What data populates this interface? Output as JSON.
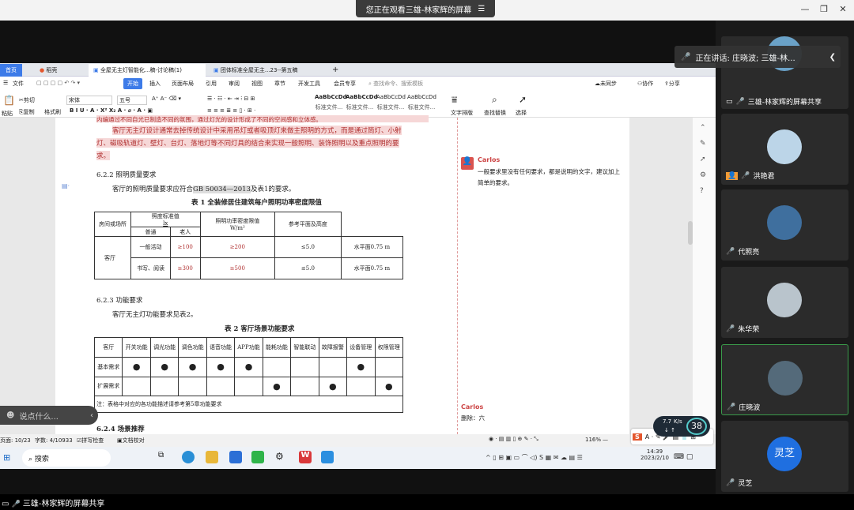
{
  "meeting": {
    "banner": "您正在观看三雄-林家辉的屏幕",
    "speaking": "正在讲话: 庄晓波; 三雄-林...",
    "share_label": "三雄-林家辉的屏幕共享",
    "chat_placeholder": "说点什么..."
  },
  "participants": [
    {
      "name": "三雄-林家辉的屏幕共享"
    },
    {
      "name": "洪艳君"
    },
    {
      "name": "代照亮"
    },
    {
      "name": "朱华荣"
    },
    {
      "name": "庄晓波"
    },
    {
      "name": "灵芝",
      "initials": "灵芝"
    }
  ],
  "tabs": {
    "home": "首页",
    "t1": "稻壳",
    "t2": "全屋无主灯智能化...稿-讨论稿(1)",
    "t3": "团体标准全屋无主...23--第五稿"
  },
  "menu": [
    "文件",
    "开始",
    "插入",
    "页面布局",
    "引用",
    "审阅",
    "视图",
    "章节",
    "开发工具",
    "会员专享"
  ],
  "menu_search": "查找命令、搜索模板",
  "menu_right": [
    "未同步",
    "协作",
    "分享"
  ],
  "ribbon": {
    "cut": "剪切",
    "copy": "复制",
    "paste": "粘贴",
    "format_painter": "格式刷",
    "font": "宋体",
    "size": "五号",
    "styles": [
      "AaBbCcDd",
      "AaBbCcDd",
      "AaBbCcDd",
      "AaBbCcDd"
    ],
    "style_labels": [
      "标准文件...",
      "标准文件...",
      "标准文件...",
      "标准文件..."
    ],
    "text_layout": "文字排版",
    "find_replace": "查找替换",
    "select": "选择"
  },
  "doc": {
    "p0": "内编通过不同自光已制造不同的氛围，通过灯光的设计形成了不同的空间感和立体感。",
    "p1a": "客厅无主灯设计通常去掉传统设计中采用吊灯或者吸顶灯来做主照明的方式，而是通过筒灯、小射",
    "p1b": "灯、磁吸轨道灯、壁灯、台灯、落地灯等不同灯具的结合来实现一般照明、装饰照明以及重点照明的要",
    "p1c": "求。",
    "h622": "6.2.2   照明质量要求",
    "p2a": "客厅的照明质量要求应符合",
    "p2b": "GB 50034—2013",
    "p2c": "及表1的要求。",
    "t1_title": "表 1   全装修居住建筑每户照明功率密度限值",
    "t1": {
      "h_room": "房间或场所",
      "h_std": "照度标准值",
      "h_lx": "lx",
      "h_normal": "普通",
      "h_old": "老人",
      "h_lpd": "照明功率密度限值",
      "h_unit": "W/m²",
      "h_plane": "参考平面及高度",
      "room": "客厅",
      "r1": [
        "一般活动",
        "≥100",
        "≥200",
        "≤5.0",
        "水平面0.75 m"
      ],
      "r2": [
        "书写、阅读",
        "≥300",
        "≥500",
        "≤5.0",
        "水平面0.75 m"
      ]
    },
    "h623": "6.2.3   功能要求",
    "p3": "客厅无主灯功能要求见表2。",
    "t2_title": "表 2   客厅场景功能要求",
    "t2": {
      "head": [
        "客厅",
        "开关功能",
        "调光功能",
        "调色功能",
        "语音功能",
        "APP功能",
        "能耗功能",
        "智能联动",
        "故障报警",
        "设备管理",
        "权限管理"
      ],
      "r1": [
        "基本需求",
        "●",
        "●",
        "●",
        "●",
        "●",
        "",
        "",
        "",
        "●",
        ""
      ],
      "r2": [
        "扩展需求",
        "",
        "",
        "",
        "",
        "",
        "●",
        "",
        "●",
        "",
        "●"
      ],
      "note": "注：表格中对应的各功能描述请参考第5章功能要求"
    },
    "h624": "6.2.4   场景推荐"
  },
  "comments": [
    {
      "author": "Carlos",
      "text": "一般要求里没有任何要求，都是说明的文字，建议加上简单的要求。"
    },
    {
      "author": "Carlos",
      "text": "删除：六"
    }
  ],
  "status": {
    "page": "页面: 10/23",
    "words": "字数: 4/10933",
    "spell": "拼写检查",
    "proof": "文档校对",
    "zoom": "116%",
    "speed": "7.7",
    "speed_unit": "K/s",
    "percent": "38"
  },
  "taskbar": {
    "search": "搜索",
    "time": "14:39",
    "date": "2023/2/10"
  }
}
